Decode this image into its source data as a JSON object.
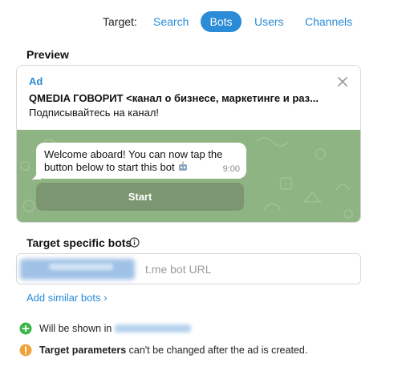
{
  "tabs": {
    "label": "Target:",
    "items": [
      "Search",
      "Bots",
      "Users",
      "Channels"
    ],
    "active": "Bots"
  },
  "preview": {
    "title": "Preview",
    "ad_label": "Ad",
    "ad_title": "QMEDIA ГОВОРИТ <канал о бизнесе, маркетинге и раз...",
    "ad_text": "Подписывайтесь на канал!",
    "bubble_text": "Welcome aboard! You can now tap the button below to start this bot",
    "bubble_time": "9:00",
    "start_label": "Start"
  },
  "target": {
    "title": "Target specific bots",
    "placeholder": "t.me bot URL",
    "add_similar": "Add similar bots ›"
  },
  "notes": {
    "shown_in": "Will be shown in",
    "params_bold": "Target parameters",
    "params_rest": " can't be changed after the ad is created."
  },
  "colors": {
    "accent": "#2a8bd6",
    "chat_bg": "#8fb483",
    "success": "#3bb54a",
    "warning": "#f0a33a"
  }
}
